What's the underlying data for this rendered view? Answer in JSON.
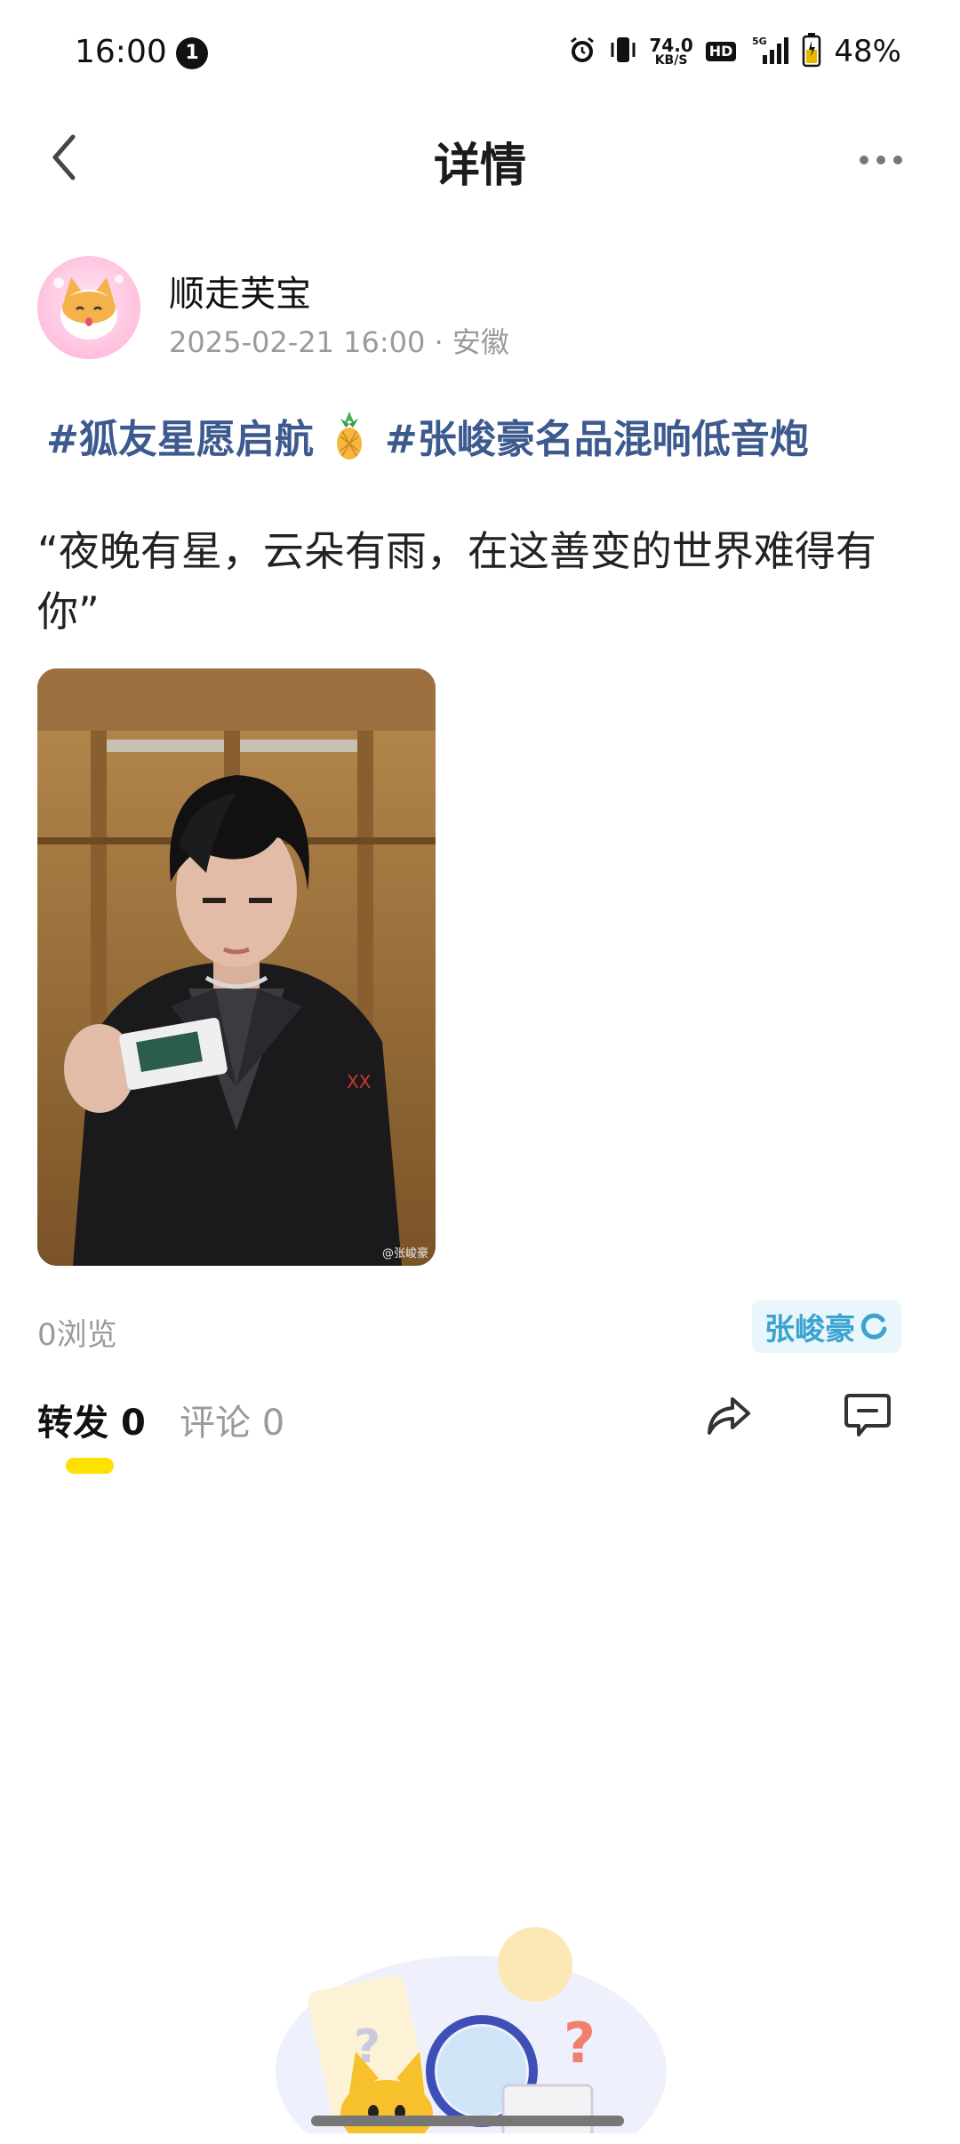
{
  "status_bar": {
    "time": "16:00",
    "notification_count": "1",
    "net_speed_value": "74.0",
    "net_speed_unit": "KB/S",
    "hd_label": "HD",
    "network_label": "5G",
    "battery": "48%",
    "icons": [
      "alarm-icon",
      "vibrate-icon",
      "signal-icon",
      "battery-icon"
    ]
  },
  "header": {
    "title": "详情",
    "back_icon": "chevron-left-icon",
    "more_icon": "more-dots-icon"
  },
  "post": {
    "author": "顺走芙宝",
    "date": "2025-02-21 16:00",
    "separator": "·",
    "location": "安徽",
    "topic_1": "#狐友星愿启航",
    "topic_2": "#张峻豪名品混响低音炮",
    "text": "“夜晚有星，云朵有雨，在这善变的世界难得有你”",
    "photo_watermark": "@张峻豪",
    "views": "0浏览",
    "artist_tag": "张峻豪"
  },
  "tabs": {
    "repost_label": "转发",
    "repost_count": "0",
    "comment_label": "评论",
    "comment_count": "0",
    "active": "repost"
  },
  "colors": {
    "topic": "#3d5a8f",
    "tab_indicator": "#ffe100",
    "artist_tag_text": "#3aa3cf",
    "artist_tag_bg": "#e9f6fb",
    "meta_gray": "#9a9a9a"
  }
}
